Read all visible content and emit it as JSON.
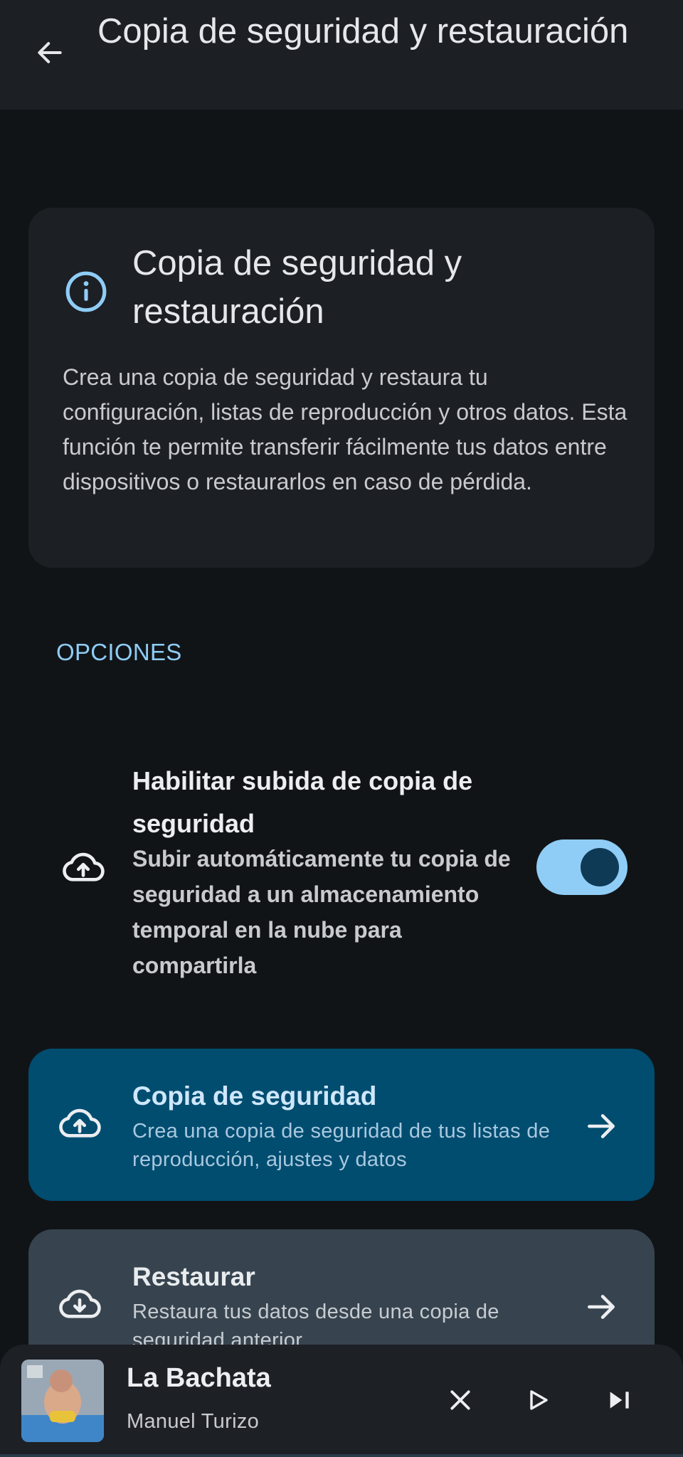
{
  "header": {
    "title": "Copia de seguridad y restauración"
  },
  "info_card": {
    "title": "Copia de seguridad y restauración",
    "description": "Crea una copia de seguridad y restaura tu configuración, listas de reproducción y otros datos. Esta función te permite transferir fácilmente tus datos entre dispositivos o restaurarlos en caso de pérdida."
  },
  "section": {
    "label": "OPCIONES"
  },
  "upload_toggle": {
    "title": "Habilitar subida de copia de seguridad",
    "subtitle": "Subir automáticamente tu copia de seguridad a un almacenamiento temporal en la nube para compartirla",
    "enabled": true,
    "icon": "cloud-upload-icon"
  },
  "backup_card": {
    "title": "Copia de seguridad",
    "subtitle": "Crea una copia de seguridad de tus listas de reproducción, ajustes y datos",
    "icon": "cloud-upload-icon"
  },
  "restore_card": {
    "title": "Restaurar",
    "subtitle": "Restaura tus datos desde una copia de seguridad anterior",
    "icon": "cloud-download-icon"
  },
  "player": {
    "title": "La Bachata",
    "artist": "Manuel Turizo",
    "controls": [
      "close-icon",
      "play-icon",
      "skip-next-icon"
    ]
  },
  "colors": {
    "background": "#111417",
    "surface": "#1c1f24",
    "accent": "#8fcdf6",
    "backup_card": "#004d70",
    "restore_card": "#37444f"
  }
}
